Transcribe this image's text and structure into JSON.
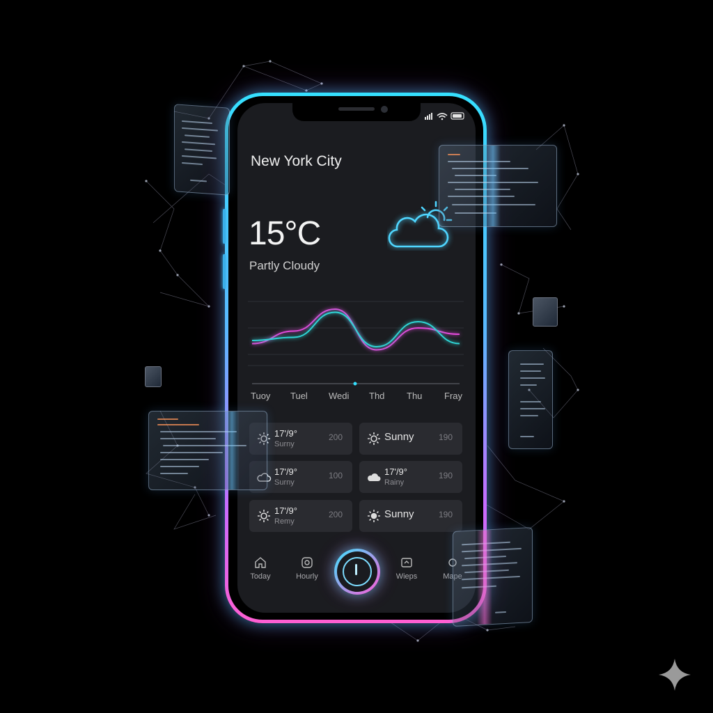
{
  "location": {
    "city": "New York City"
  },
  "current": {
    "temperature": "15°C",
    "condition": "Partly Cloudy",
    "icon": "partly-cloudy-icon"
  },
  "chart_data": {
    "type": "line",
    "x": [
      "Tuoy",
      "Tuel",
      "Wedi",
      "Thd",
      "Thu",
      "Fray"
    ],
    "series": [
      {
        "values": [
          0.35,
          0.55,
          0.9,
          0.25,
          0.6,
          0.5
        ],
        "color": "#e04ad8"
      },
      {
        "values": [
          0.4,
          0.45,
          0.85,
          0.3,
          0.7,
          0.35
        ],
        "color": "#2fd6d6"
      }
    ],
    "ylim": [
      0,
      1
    ]
  },
  "forecast": [
    {
      "line1": "17'/9°",
      "line2": "Surny",
      "value": "200",
      "icon": "sun-icon"
    },
    {
      "line1": "Sunny",
      "line2": "",
      "value": "190",
      "icon": "sun-icon"
    },
    {
      "line1": "17'/9°",
      "line2": "Surny",
      "value": "100",
      "icon": "cloud-icon"
    },
    {
      "line1": "17'/9°",
      "line2": "Rainy",
      "value": "190",
      "icon": "cloud-icon"
    },
    {
      "line1": "17'/9°",
      "line2": "Remy",
      "value": "200",
      "icon": "sun-icon"
    },
    {
      "line1": "Sunny",
      "line2": "",
      "value": "190",
      "icon": "sun-icon"
    }
  ],
  "tabs": [
    {
      "label": "Today",
      "icon": "home-icon"
    },
    {
      "label": "Hourly",
      "icon": "clock-icon"
    },
    {
      "label": "",
      "icon": "power-icon"
    },
    {
      "label": "Wieps",
      "icon": "map-icon"
    },
    {
      "label": "Mape",
      "icon": "settings-icon"
    }
  ],
  "colors": {
    "accent_cyan": "#35e0ff",
    "accent_magenta": "#ff5fd2",
    "screen_bg": "#1b1c20",
    "card_bg": "#2a2b30"
  }
}
